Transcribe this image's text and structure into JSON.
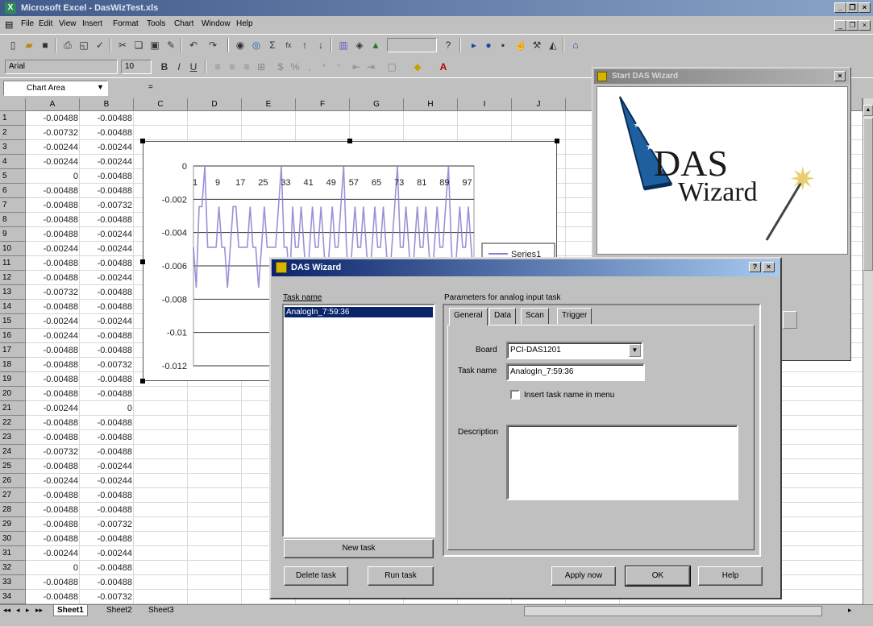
{
  "excel": {
    "title": "Microsoft Excel - DasWizTest.xls",
    "menu": [
      "File",
      "Edit",
      "View",
      "Insert",
      "Format",
      "Tools",
      "Chart",
      "Window",
      "Help"
    ],
    "font_name": "Arial",
    "font_size": "10",
    "name_box": "Chart Area",
    "columns": [
      "A",
      "B",
      "C",
      "D",
      "E",
      "F",
      "G",
      "H",
      "I",
      "J"
    ],
    "rows": [
      {
        "n": "1",
        "a": "-0.00488",
        "b": "-0.00488"
      },
      {
        "n": "2",
        "a": "-0.00732",
        "b": "-0.00488"
      },
      {
        "n": "3",
        "a": "-0.00244",
        "b": "-0.00244"
      },
      {
        "n": "4",
        "a": "-0.00244",
        "b": "-0.00244"
      },
      {
        "n": "5",
        "a": "0",
        "b": "-0.00488"
      },
      {
        "n": "6",
        "a": "-0.00488",
        "b": "-0.00488"
      },
      {
        "n": "7",
        "a": "-0.00488",
        "b": "-0.00732"
      },
      {
        "n": "8",
        "a": "-0.00488",
        "b": "-0.00488"
      },
      {
        "n": "9",
        "a": "-0.00488",
        "b": "-0.00244"
      },
      {
        "n": "10",
        "a": "-0.00244",
        "b": "-0.00244"
      },
      {
        "n": "11",
        "a": "-0.00488",
        "b": "-0.00488"
      },
      {
        "n": "12",
        "a": "-0.00488",
        "b": "-0.00244"
      },
      {
        "n": "13",
        "a": "-0.00732",
        "b": "-0.00488"
      },
      {
        "n": "14",
        "a": "-0.00488",
        "b": "-0.00488"
      },
      {
        "n": "15",
        "a": "-0.00244",
        "b": "-0.00244"
      },
      {
        "n": "16",
        "a": "-0.00244",
        "b": "-0.00488"
      },
      {
        "n": "17",
        "a": "-0.00488",
        "b": "-0.00488"
      },
      {
        "n": "18",
        "a": "-0.00488",
        "b": "-0.00732"
      },
      {
        "n": "19",
        "a": "-0.00488",
        "b": "-0.00488"
      },
      {
        "n": "20",
        "a": "-0.00488",
        "b": "-0.00488"
      },
      {
        "n": "21",
        "a": "-0.00244",
        "b": "0"
      },
      {
        "n": "22",
        "a": "-0.00488",
        "b": "-0.00488"
      },
      {
        "n": "23",
        "a": "-0.00488",
        "b": "-0.00488"
      },
      {
        "n": "24",
        "a": "-0.00732",
        "b": "-0.00488"
      },
      {
        "n": "25",
        "a": "-0.00488",
        "b": "-0.00244"
      },
      {
        "n": "26",
        "a": "-0.00244",
        "b": "-0.00244"
      },
      {
        "n": "27",
        "a": "-0.00488",
        "b": "-0.00488"
      },
      {
        "n": "28",
        "a": "-0.00488",
        "b": "-0.00488"
      },
      {
        "n": "29",
        "a": "-0.00488",
        "b": "-0.00732"
      },
      {
        "n": "30",
        "a": "-0.00488",
        "b": "-0.00488"
      },
      {
        "n": "31",
        "a": "-0.00244",
        "b": "-0.00244"
      },
      {
        "n": "32",
        "a": "0",
        "b": "-0.00488"
      },
      {
        "n": "33",
        "a": "-0.00488",
        "b": "-0.00488"
      },
      {
        "n": "34",
        "a": "-0.00488",
        "b": "-0.00732"
      }
    ],
    "sheet_tabs": [
      "Sheet1",
      "Sheet2",
      "Sheet3"
    ]
  },
  "chart_data": {
    "type": "line",
    "x_tick_labels": [
      "1",
      "9",
      "17",
      "25",
      "33",
      "41",
      "49",
      "57",
      "65",
      "73",
      "81",
      "89",
      "97"
    ],
    "y_tick_labels": [
      "0",
      "-0.002",
      "-0.004",
      "-0.006",
      "-0.008",
      "-0.01",
      "-0.012"
    ],
    "ylim": [
      -0.012,
      0
    ],
    "legend": "Series1",
    "legend_position": "right",
    "series": [
      {
        "name": "Series1",
        "values": [
          -0.00488,
          -0.00732,
          -0.00244,
          -0.00244,
          0,
          -0.00488,
          -0.00488,
          -0.00488,
          -0.00488,
          -0.00244,
          -0.00488,
          -0.00488,
          -0.00732,
          -0.00488,
          -0.00244,
          -0.00244,
          -0.00488,
          -0.00488,
          -0.00488,
          -0.00488,
          -0.00244,
          -0.00488,
          -0.00488,
          -0.00732,
          -0.00488,
          -0.00244,
          -0.00488,
          -0.00488,
          -0.00488,
          -0.00488,
          -0.00244,
          0,
          -0.00488,
          -0.00488,
          -0.00732,
          -0.00244,
          -0.00488,
          -0.00488,
          -0.00244,
          -0.00488,
          -0.00732,
          -0.00488,
          -0.00244,
          -0.00488,
          -0.00488,
          -0.00244,
          -0.00488,
          -0.00732,
          -0.00488,
          -0.00244,
          -0.00488,
          -0.00488,
          -0.00244,
          0,
          -0.00488,
          -0.00732,
          -0.00488,
          -0.00244,
          -0.00488,
          -0.00488,
          -0.00244,
          -0.00488,
          -0.00732,
          -0.00488,
          -0.00244,
          -0.00488,
          -0.00488,
          -0.00244,
          -0.00488,
          -0.00732,
          -0.00488,
          -0.00244,
          0,
          -0.00488,
          -0.00488,
          -0.00244,
          -0.00488,
          -0.00732,
          -0.00488,
          -0.00244,
          -0.00488,
          -0.00488,
          -0.00244,
          -0.00488,
          -0.00732,
          -0.00488,
          -0.00244,
          -0.00488,
          -0.00488,
          -0.00244,
          0,
          -0.00488,
          -0.00732,
          -0.00488,
          -0.00244,
          -0.00488,
          -0.00488,
          -0.00244,
          -0.00488,
          -0.00732
        ]
      }
    ]
  },
  "start_wizard": {
    "title": "Start DAS Wizard",
    "logo_line1": "DAS",
    "logo_line2": "Wizard"
  },
  "das_wizard": {
    "title": "DAS Wizard",
    "task_name_label": "Task name",
    "tasks": [
      "AnalogIn_7:59:36"
    ],
    "params_label": "Parameters for analog input task",
    "tabs": [
      "General",
      "Data",
      "Scan",
      "Trigger"
    ],
    "board_label": "Board",
    "board_value": "PCI-DAS1201",
    "task_name_field_label": "Task name",
    "task_name_value": "AnalogIn_7:59:36",
    "insert_checkbox_label": "Insert task name in menu",
    "description_label": "Description",
    "description_value": "",
    "buttons": {
      "new_task": "New task",
      "delete_task": "Delete task",
      "run_task": "Run task",
      "apply_now": "Apply now",
      "ok": "OK",
      "help": "Help"
    }
  }
}
